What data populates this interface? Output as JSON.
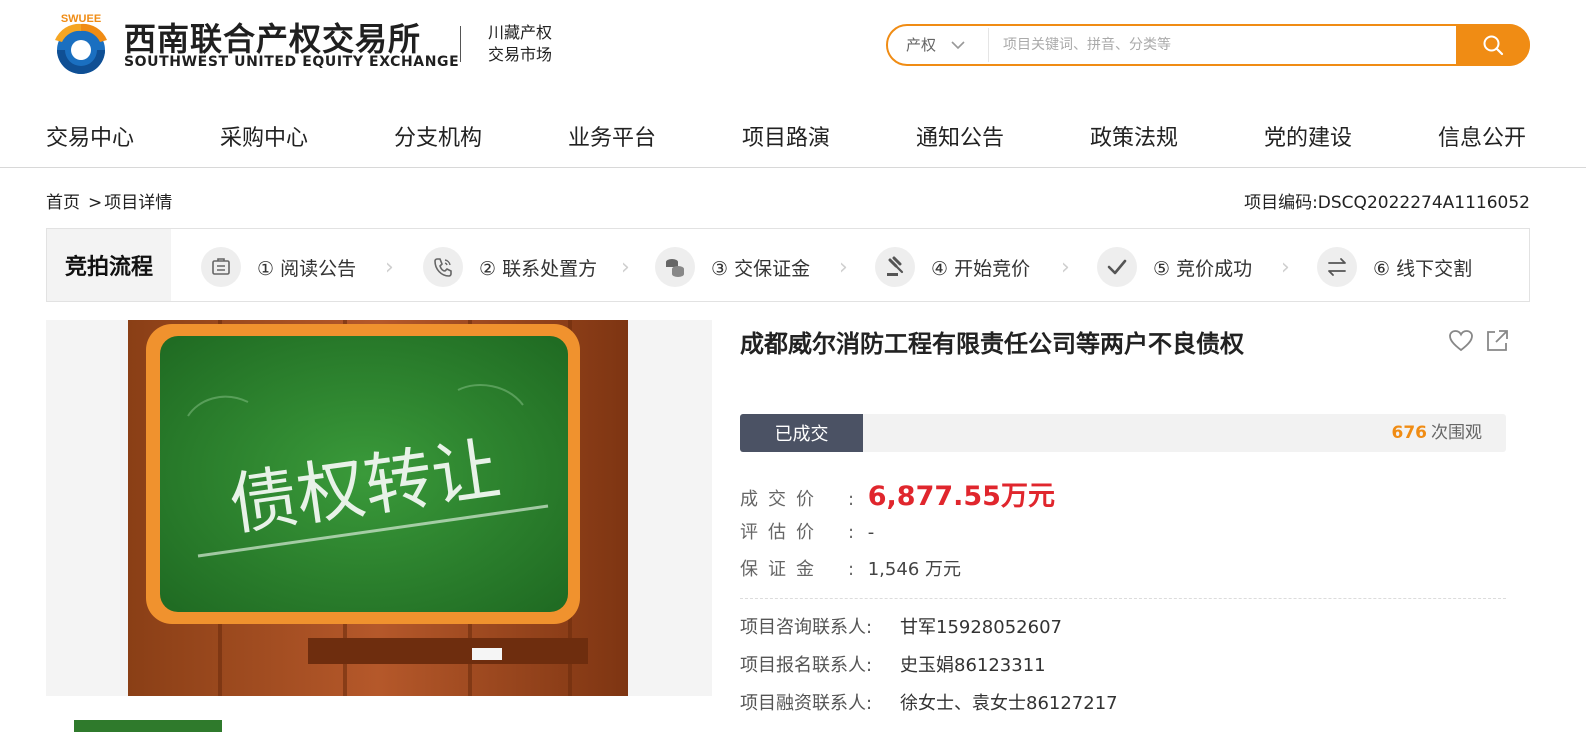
{
  "header": {
    "brand_cn": "西南联合产权交易所",
    "brand_en": "SOUTHWEST UNITED EQUITY EXCHANGE",
    "sub_brand_line1": "川藏产权",
    "sub_brand_line2": "交易市场",
    "logo_text": "SWUEE",
    "search": {
      "category": "产权",
      "placeholder": "项目关键词、拼音、分类等"
    }
  },
  "nav": {
    "items": [
      "交易中心",
      "采购中心",
      "分支机构",
      "业务平台",
      "项目路演",
      "通知公告",
      "政策法规",
      "党的建设",
      "信息公开"
    ]
  },
  "breadcrumb": {
    "home": "首页",
    "separator": ">",
    "current": "项目详情"
  },
  "project_code": "项目编码:DSCQ2022274A1116052",
  "process": {
    "title": "竞拍流程",
    "steps": [
      {
        "label": "① 阅读公告",
        "icon": "notice-icon"
      },
      {
        "label": "② 联系处置方",
        "icon": "phone-icon"
      },
      {
        "label": "③ 交保证金",
        "icon": "coins-icon"
      },
      {
        "label": "④ 开始竞价",
        "icon": "gavel-icon"
      },
      {
        "label": "⑤ 竞价成功",
        "icon": "check-icon"
      },
      {
        "label": "⑥ 线下交割",
        "icon": "exchange-icon"
      }
    ],
    "arrow": "›"
  },
  "gallery": {
    "image_text": "债权转让"
  },
  "detail": {
    "title": "成都威尔消防工程有限责任公司等两户不良债权",
    "status": "已成交",
    "views_count": "676",
    "views_label": "次围观",
    "fields": {
      "deal_price_label": "成交价",
      "deal_price_value": "6,877.55万元",
      "appraisal_label": "评估价",
      "appraisal_value": "-",
      "deposit_label": "保证金",
      "deposit_value": "1,546 万元"
    },
    "contacts": [
      {
        "label": "项目咨询联系人:",
        "value": "甘军15928052607"
      },
      {
        "label": "项目报名联系人:",
        "value": "史玉娟86123311"
      },
      {
        "label": "项目融资联系人:",
        "value": "徐女士、袁女士86127217"
      }
    ]
  },
  "colors": {
    "accent": "#f08c14",
    "price": "#e0262d",
    "badge": "#4b5264",
    "logo_blue": "#1a6fc0",
    "board_green": "#2f7a2c"
  }
}
